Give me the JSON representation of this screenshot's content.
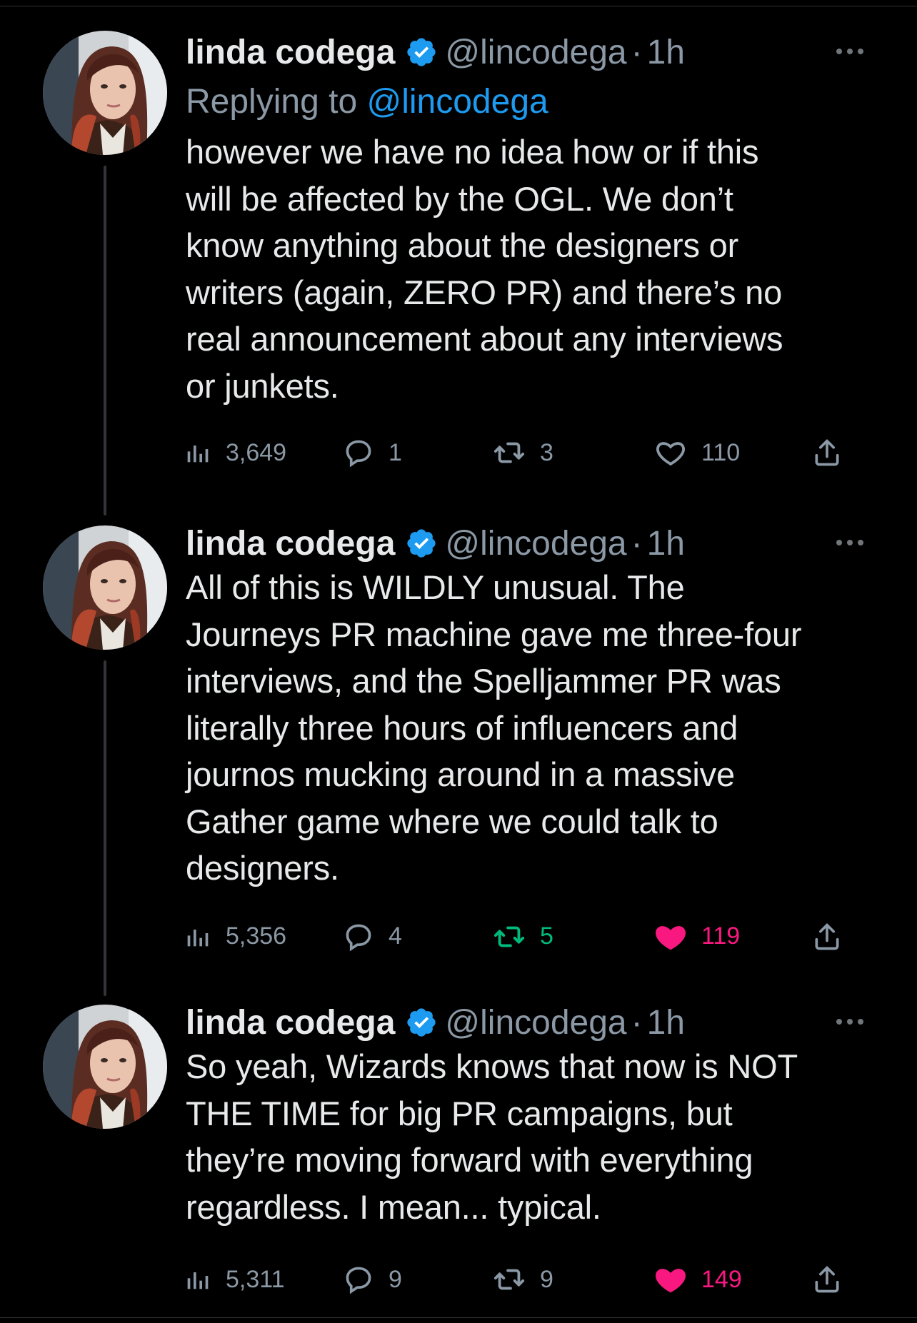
{
  "tweets": [
    {
      "author_name": "linda codega",
      "handle": "@lincodega",
      "dot": "·",
      "time": "1h",
      "replying_to_prefix": "Replying to",
      "replying_to_handle": "@lincodega",
      "text": "however we have no idea how or if this\nwill be affected by the OGL. We don’t\nknow anything about the designers or\nwriters (again, ZERO PR) and there’s no\nreal announcement about any interviews\nor junkets.",
      "views": "3,649",
      "replies": "1",
      "retweets": "3",
      "likes": "110",
      "retweeted": false,
      "liked": false
    },
    {
      "author_name": "linda codega",
      "handle": "@lincodega",
      "dot": "·",
      "time": "1h",
      "text": "All of this is WILDLY unusual. The\nJourneys PR machine gave me three-four\ninterviews, and the Spelljammer PR was\nliterally three hours of influencers and\njournos mucking around in a massive\nGather game where we could talk to\ndesigners.",
      "views": "5,356",
      "replies": "4",
      "retweets": "5",
      "likes": "119",
      "retweeted": true,
      "liked": true
    },
    {
      "author_name": "linda codega",
      "handle": "@lincodega",
      "dot": "·",
      "time": "1h",
      "text": "So yeah, Wizards knows that now is NOT\nTHE TIME for big PR campaigns, but\nthey’re moving forward with everything\nregardless. I mean... typical.",
      "views": "5,311",
      "replies": "9",
      "retweets": "9",
      "likes": "149",
      "retweeted": false,
      "liked": true
    }
  ],
  "icons": {
    "verified": "verified-badge-icon",
    "views": "views-bar-chart-icon",
    "reply": "reply-bubble-icon",
    "retweet": "retweet-icon",
    "like": "heart-icon",
    "share": "share-upload-icon",
    "more": "more-dots-icon"
  },
  "colors": {
    "background": "#000000",
    "text": "#e7e9ea",
    "secondary": "#8b98a5",
    "link": "#1d9bf0",
    "retweet_active": "#00ba7c",
    "like_active": "#f91880"
  }
}
